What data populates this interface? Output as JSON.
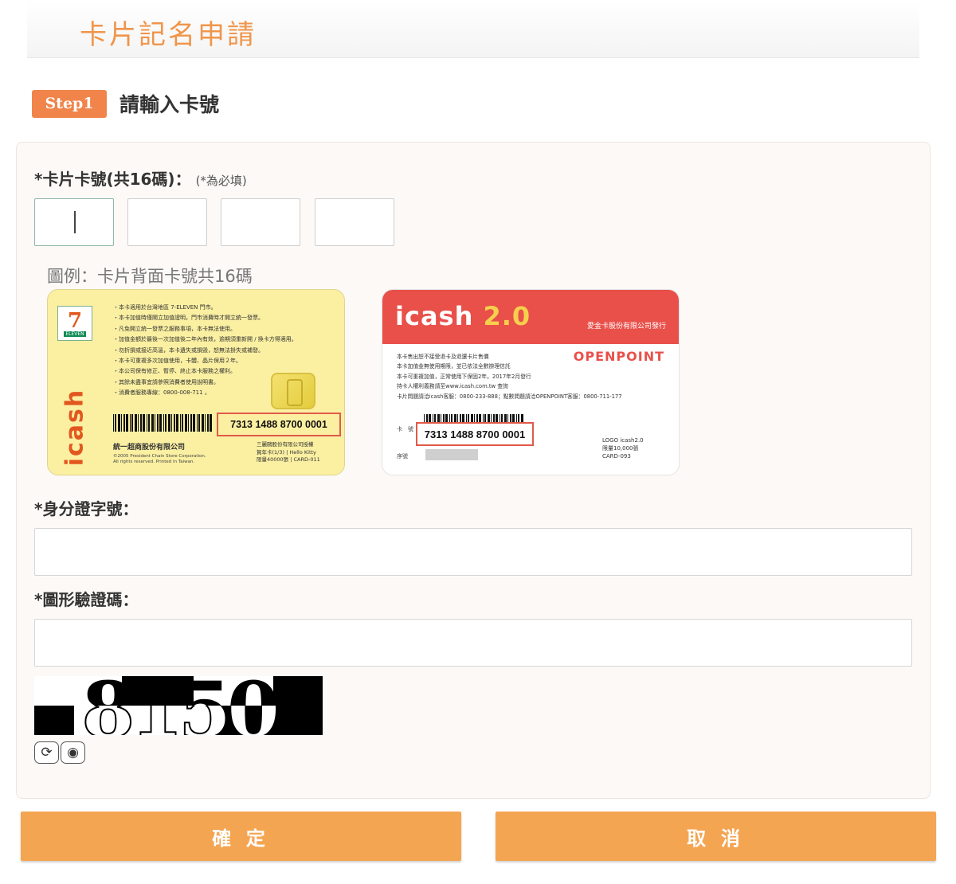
{
  "page": {
    "title": "卡片記名申請"
  },
  "step": {
    "badge": "Step1",
    "title": "請輸入卡號"
  },
  "card_number": {
    "label": "*卡片卡號(共16碼)：",
    "note": "(*為必填)",
    "segments": [
      "",
      "",
      "",
      ""
    ]
  },
  "example": {
    "caption": "圖例：卡片背面卡號共16碼",
    "card1": {
      "brand_vertical": "icash",
      "logo_number": "7",
      "logo_text": "ELEVEN",
      "terms": [
        "・本卡適用於台灣地區 7-ELEVEN 門市。",
        "・本卡加值時僅開立加值證明，門市消費時才開立統一發票。",
        "・凡免開立統一發票之服務事項，本卡無法使用。",
        "・加值金額於最後一次加值後二年內有效，逾期須重新開 / 換卡方得適用。",
        "・勿折損或接近高溫，本卡遺失或損毀，恕無法掛失或補發。",
        "・本卡可重複多次加值使用，卡體、晶片保用２年。",
        "・本公司保有修正、暫停、終止本卡服務之權利。",
        "・其餘未盡事宜請參照消費者使用說明書。",
        "・消費者服務專線：0800-008-711 。"
      ],
      "card_number": "7313 1488 8700 0001",
      "company": "統一超商股份有限公司",
      "company_en_1": "©2005 President Chain Store Corporation.",
      "company_en_2": "All rights reserved. Printed in Taiwan.",
      "issuer_lines": [
        "三麗鷗股份有限公司授權",
        "賀年卡(1/3) | Hello Kitty",
        "限量40000張 | CARD-011"
      ]
    },
    "card2": {
      "brand": "icash",
      "brand_version": "2.0",
      "issuer": "愛金卡股份有限公司發行",
      "openpoint": "OPENPOINT",
      "terms": [
        "本卡售出恕不接受退卡及退還卡片售價",
        "本卡加值金無使用期限，並已依法全數辦理信託",
        "本卡可重複加值，正常使用下保固2年。2017年2月發行",
        "持卡人權利義務請至www.icash.com.tw 查詢",
        "卡片問題請洽icash客服：0800-233-888；點數問題請洽OPENPOINT客服：0800-711-177"
      ],
      "card_label": "卡　號",
      "card_number": "7313 1488 8700 0001",
      "serial_label": "序號",
      "meta": [
        "LOGO icash2.0",
        "限量10,000張",
        "CARD-093"
      ]
    }
  },
  "id_number": {
    "label": "*身分證字號：",
    "value": ""
  },
  "captcha": {
    "label": "*圖形驗證碼：",
    "value": "",
    "code": "8150",
    "refresh_icon": "refresh-icon",
    "audio_icon": "audio-icon"
  },
  "buttons": {
    "confirm": "確 定",
    "cancel": "取 消"
  },
  "colors": {
    "accent": "#f0844a",
    "button": "#f4a552",
    "panel_bg": "#fcf9f7",
    "highlight_box": "#e05a4a"
  }
}
